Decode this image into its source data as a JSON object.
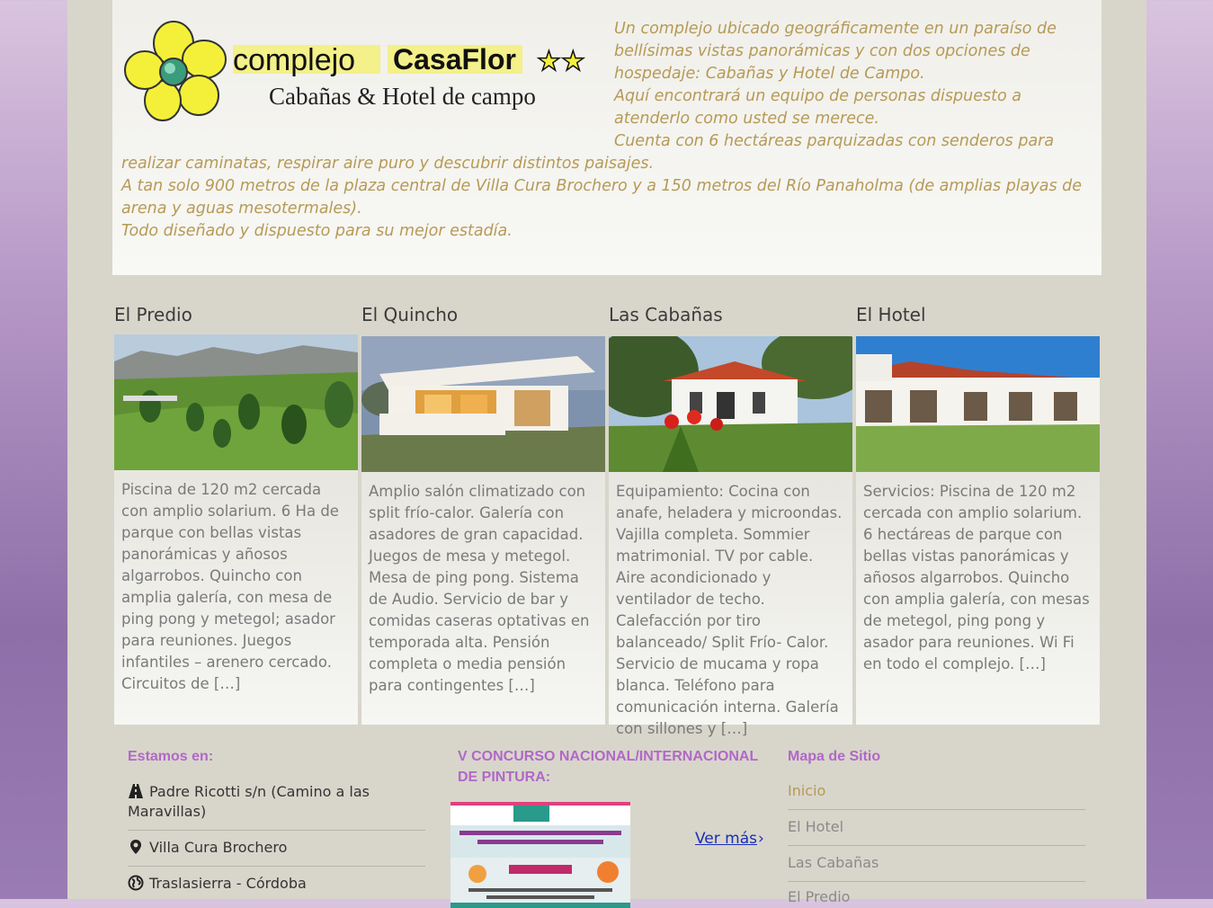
{
  "header": {
    "brand": "complejo",
    "brand_name": "CasaFlor",
    "stars": "★★",
    "tagline": "Cabañas & Hotel de campo",
    "description": [
      "Un complejo ubicado geográficamente en un paraíso de bellísimas vistas panorámicas y con dos opciones de hospedaje: Cabañas y Hotel de Campo.",
      "Aquí encontrará un equipo de personas dispuesto a atenderlo como usted se merece.",
      "Cuenta con 6 hectáreas parquizadas con senderos para realizar caminatas, respirar aire puro y descubrir distintos paisajes.",
      "A tan solo 900 metros de la plaza central de Villa Cura Brochero y a 150 metros del Río Panaholma (de amplias playas de arena y aguas mesotermales).",
      "Todo diseñado y dispuesto para su mejor estadía."
    ]
  },
  "cards": [
    {
      "title": "El Predio",
      "text": "Piscina de 120 m2 cercada con amplio solarium. 6 Ha de parque con bellas vistas panorámicas y añosos algarrobos. Quincho con amplia galería, con mesa de ping pong y metegol; asador para reuniones. Juegos infantiles – arenero cercado. Circuitos de […]"
    },
    {
      "title": "El Quincho",
      "text": "Amplio salón climatizado con split frío-calor. Galería con asadores de gran capacidad. Juegos de mesa y metegol. Mesa de ping pong. Sistema de Audio. Servicio de bar y comidas caseras optativas en temporada alta. Pensión completa o media pensión para contingentes […]"
    },
    {
      "title": "Las Cabañas",
      "text": "Equipamiento: Cocina con anafe, heladera y microondas. Vajilla completa. Sommier matrimonial. TV por cable. Aire acondicionado y ventilador de techo. Calefacción por tiro balanceado/ Split Frío- Calor. Servicio de mucama y ropa blanca. Teléfono para comunicación interna. Galería con sillones y […]"
    },
    {
      "title": "El Hotel",
      "text": "Servicios: Piscina de 120 m2 cercada con amplio solarium. 6 hectáreas de parque con bellas vistas panorámicas y añosos algarrobos. Quincho con amplia galería, con mesas de metegol, ping pong y asador para reuniones. Wi Fi en todo el complejo. […]"
    }
  ],
  "footer": {
    "location_heading": "Estamos en:",
    "address_lines": [
      "Padre Ricotti s/n (Camino a las Maravillas)",
      "Villa Cura Brochero",
      "Traslasierra - Córdoba"
    ],
    "contest_heading": "V CONCURSO NACIONAL/INTERNACIONAL DE PINTURA:",
    "more_link": "Ver más",
    "more_chevron": "›",
    "sitemap_heading": "Mapa de Sitio",
    "sitemap_links": [
      "Inicio",
      "El Hotel",
      "Las Cabañas",
      "El Predio"
    ]
  },
  "colors": {
    "accent_gold": "#b69a56",
    "heading_purple": "#b267c8",
    "link_blue": "#1a2eb8"
  }
}
